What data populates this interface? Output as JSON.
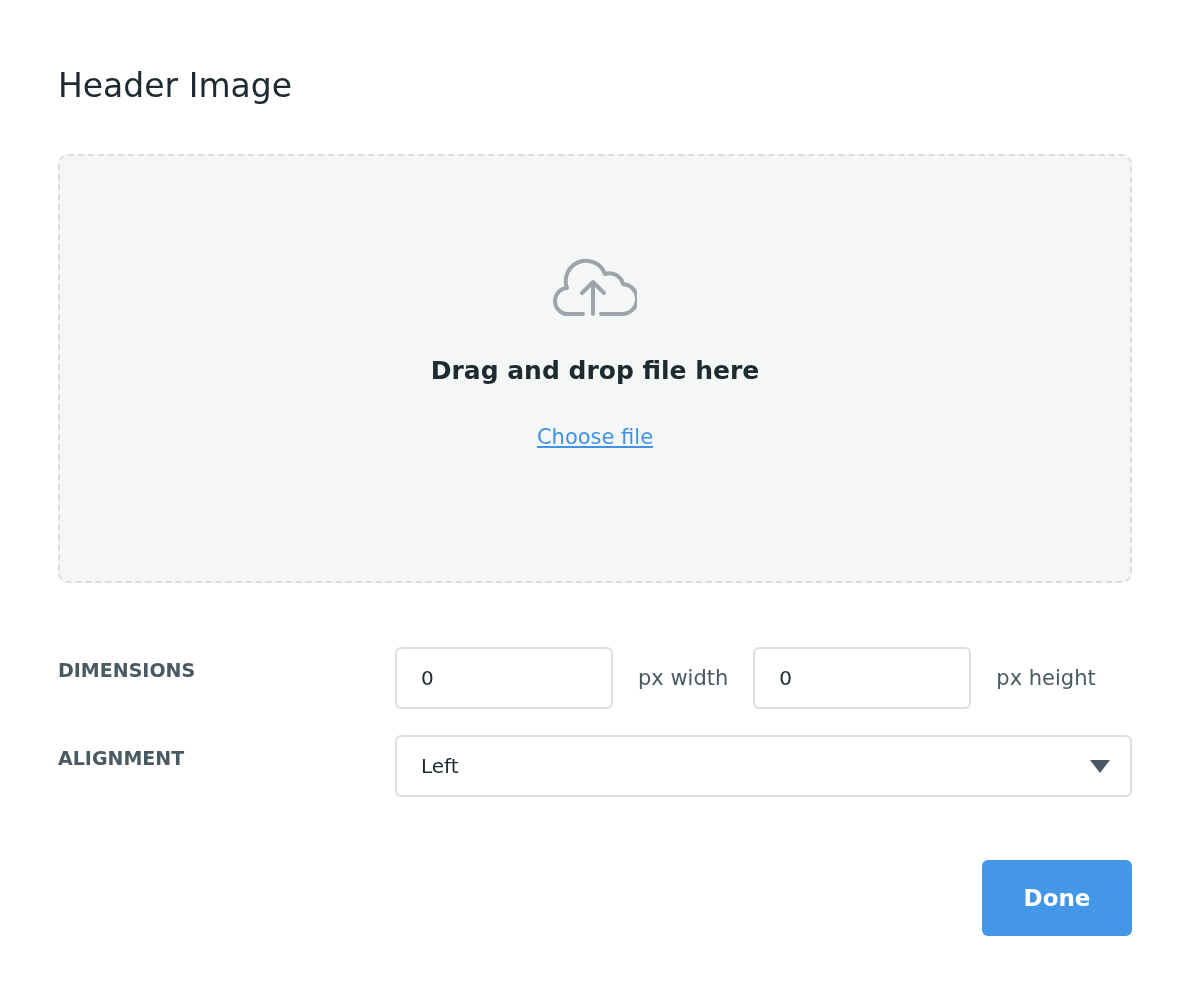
{
  "title": "Header Image",
  "dropzone": {
    "prompt": "Drag and drop file here",
    "link": "Choose file"
  },
  "dimensions": {
    "label": "DIMENSIONS",
    "width": {
      "value": "0",
      "unit": "px width"
    },
    "height": {
      "value": "0",
      "unit": "px height"
    }
  },
  "alignment": {
    "label": "ALIGNMENT",
    "value": "Left"
  },
  "done_button": "Done"
}
